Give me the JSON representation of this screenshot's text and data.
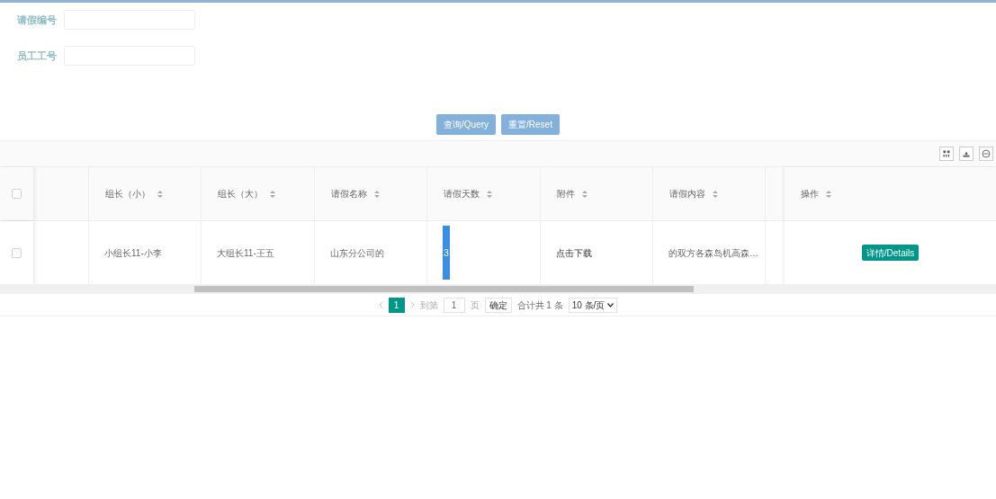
{
  "search_form": {
    "fields": [
      {
        "label": "请假编号"
      },
      {
        "label": "员工工号"
      }
    ],
    "buttons": [
      {
        "label": "查询/Query"
      },
      {
        "label": "重置/Reset"
      }
    ]
  },
  "table": {
    "all_checked": false,
    "columns": [
      {
        "kind": "blank"
      },
      {
        "kind": "text",
        "label": "组长（小）",
        "sortable": true
      },
      {
        "kind": "text",
        "label": "组长（大）",
        "sortable": true
      },
      {
        "kind": "text",
        "label": "请假名称",
        "sortable": true
      },
      {
        "kind": "bar",
        "label": "请假天数",
        "sortable": true
      },
      {
        "kind": "link",
        "label": "附件",
        "sortable": true
      },
      {
        "kind": "text",
        "label": "请假内容",
        "sortable": true
      },
      {
        "kind": "cut"
      }
    ],
    "action_column": {
      "label": "操作",
      "sortable": true
    },
    "rows": [
      {
        "checked": false,
        "cells": [
          "",
          "小组长11-小李",
          "大组长11-王五",
          "山东分公司的",
          "3",
          "点击下载",
          "的双方各森岛机高森…",
          ""
        ],
        "action": "详情/Details"
      }
    ]
  },
  "pagination": {
    "pages": [
      {
        "label": "1",
        "selected": true
      }
    ],
    "goto_label": "到第",
    "goto_value": "1",
    "page_unit": "页",
    "confirm": "确定",
    "total": "合计共 1 条",
    "page_size": "10 条/页"
  }
}
